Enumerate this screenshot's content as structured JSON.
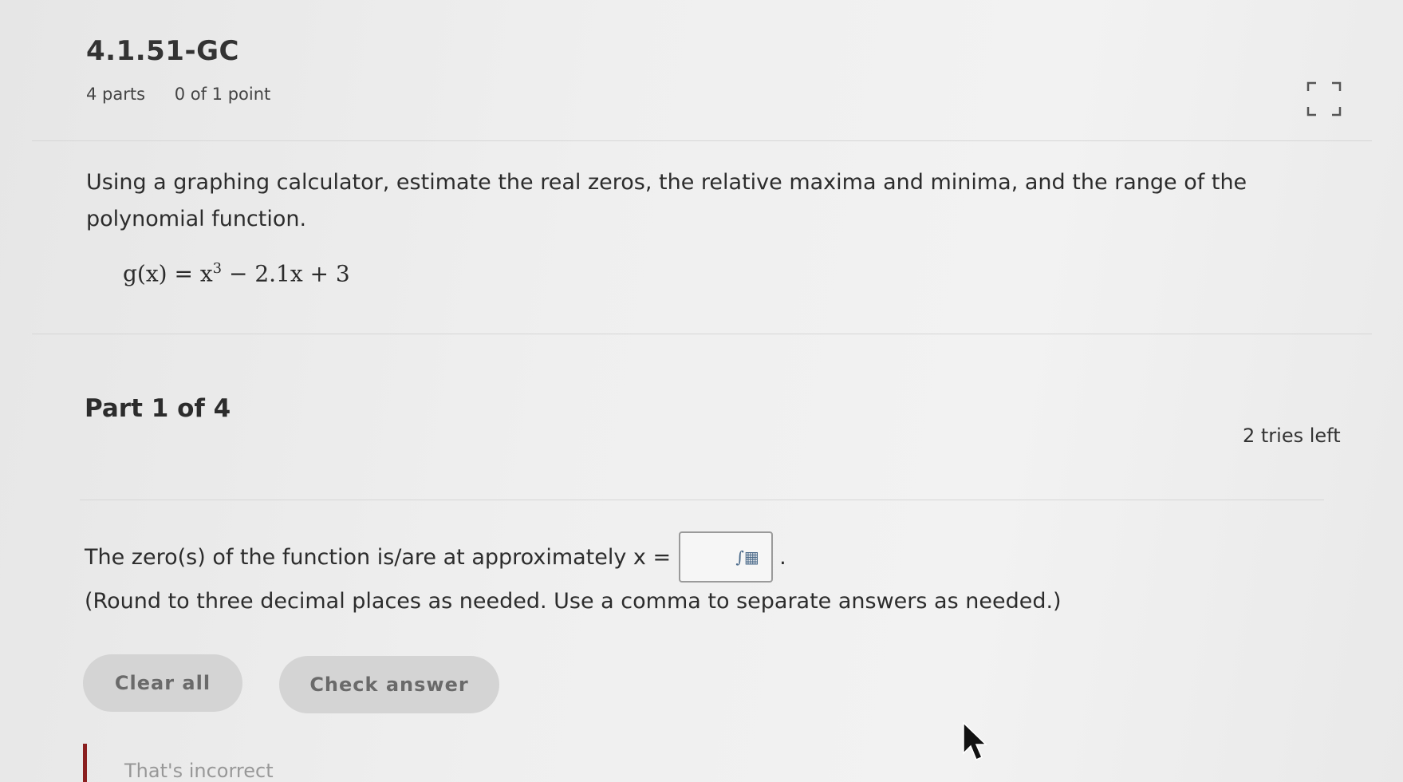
{
  "question": {
    "id": "4.1.51-GC",
    "parts": "4 parts",
    "points": "0 of 1 point"
  },
  "prompt": {
    "text": "Using a graphing calculator, estimate the real zeros, the relative maxima and minima, and the range of the polynomial function.",
    "formula_lhs": "g(x) = x",
    "formula_exp": "3",
    "formula_rhs": " − 2.1x + 3"
  },
  "part": {
    "label": "Part 1 of 4",
    "tries": "2 tries left"
  },
  "answer": {
    "question_text": "The zero(s) of the function is/are at approximately x =",
    "input_value": "",
    "period": ".",
    "hint": "(Round to three decimal places as needed. Use a comma to separate answers as needed.)"
  },
  "buttons": {
    "clear_all": "Clear all",
    "check_answer": "Check answer"
  },
  "feedback": {
    "text": "That's incorrect"
  },
  "icons": {
    "expand": "expand-icon",
    "math_palette": "math-palette-icon",
    "cursor": "mouse-cursor-icon"
  }
}
